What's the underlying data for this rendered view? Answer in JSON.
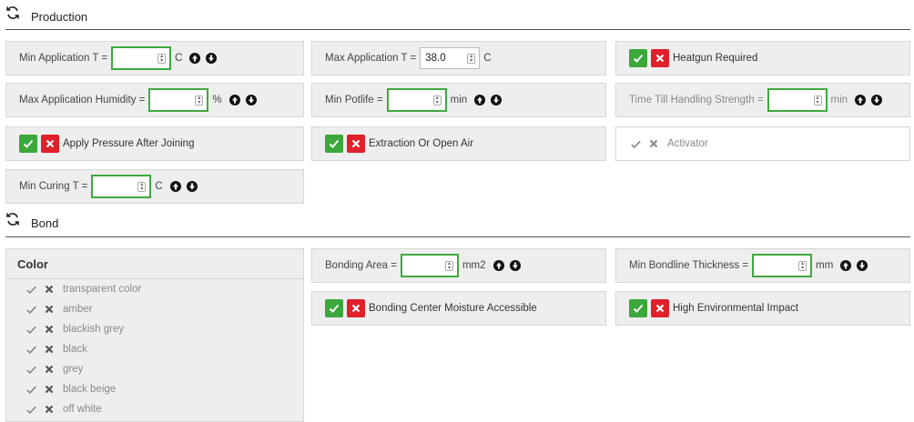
{
  "sections": {
    "production": "Production",
    "bond": "Bond"
  },
  "production": {
    "min_app_t": {
      "label": "Min Application T =",
      "value": "",
      "unit": "C"
    },
    "max_app_t": {
      "label": "Max Application T =",
      "value": "38.0",
      "unit": "C"
    },
    "heatgun": {
      "label": "Heatgun Required"
    },
    "max_humidity": {
      "label": "Max Application Humidity =",
      "value": "",
      "unit": "%"
    },
    "min_potlife": {
      "label": "Min Potlife =",
      "value": "",
      "unit": "min"
    },
    "handling": {
      "label": "Time Till Handling Strength =",
      "value": "",
      "unit": "min"
    },
    "pressure": {
      "label": "Apply Pressure After Joining"
    },
    "extraction": {
      "label": "Extraction Or Open Air"
    },
    "activator": {
      "label": "Activator"
    },
    "min_curing_t": {
      "label": "Min Curing T =",
      "value": "",
      "unit": "C"
    }
  },
  "bond": {
    "color": {
      "title": "Color",
      "options": [
        "transparent color",
        "amber",
        "blackish grey",
        "black",
        "grey",
        "black beige",
        "off white"
      ]
    },
    "bonding_area": {
      "label": "Bonding Area =",
      "value": "",
      "unit": "mm2"
    },
    "bondline": {
      "label": "Min Bondline Thickness =",
      "value": "",
      "unit": "mm"
    },
    "moisture": {
      "label": "Bonding Center Moisture Accessible"
    },
    "env_impact": {
      "label": "High Environmental Impact"
    }
  },
  "colors": {
    "accept": "#3aa83a",
    "reject": "#e0202a",
    "field_border": "#3fa93f"
  }
}
